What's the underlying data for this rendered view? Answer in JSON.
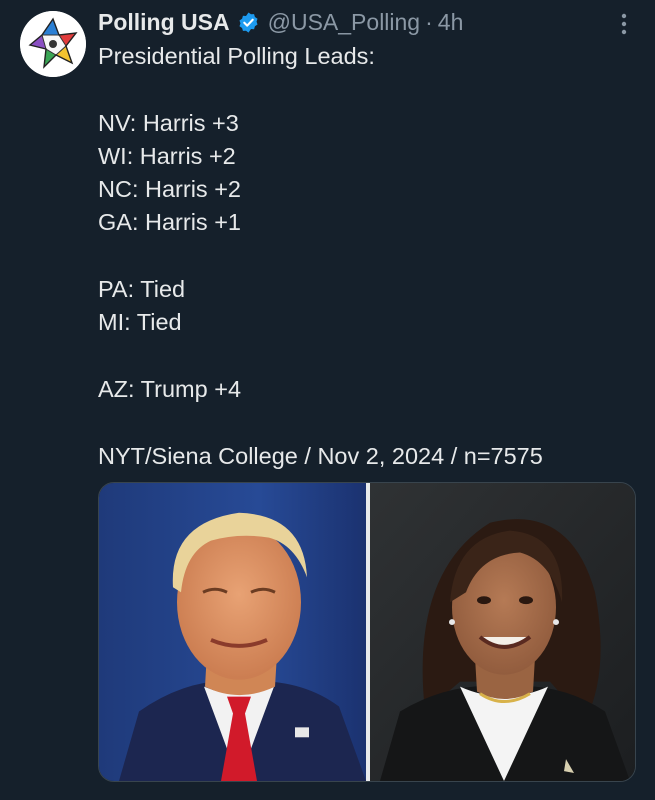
{
  "tweet": {
    "display_name": "Polling USA",
    "handle": "@USA_Polling",
    "separator": "·",
    "time": "4h",
    "lines": [
      "Presidential Polling Leads:",
      "",
      "NV: Harris +3",
      "WI: Harris +2",
      "NC: Harris +2",
      "GA: Harris +1",
      "",
      "PA: Tied",
      "MI: Tied",
      "",
      "AZ: Trump +4",
      "",
      "NYT/Siena College / Nov 2, 2024 / n=7575"
    ]
  },
  "icons": {
    "verified": "verified-badge-icon",
    "more": "more-vertical-icon",
    "avatar": "polling-usa-logo"
  },
  "colors": {
    "background": "#15202b",
    "text": "#e7e9ea",
    "secondary": "#8b98a5",
    "verified": "#1d9bf0"
  },
  "media": {
    "images": [
      "candidate-photo-left",
      "candidate-photo-right"
    ]
  }
}
